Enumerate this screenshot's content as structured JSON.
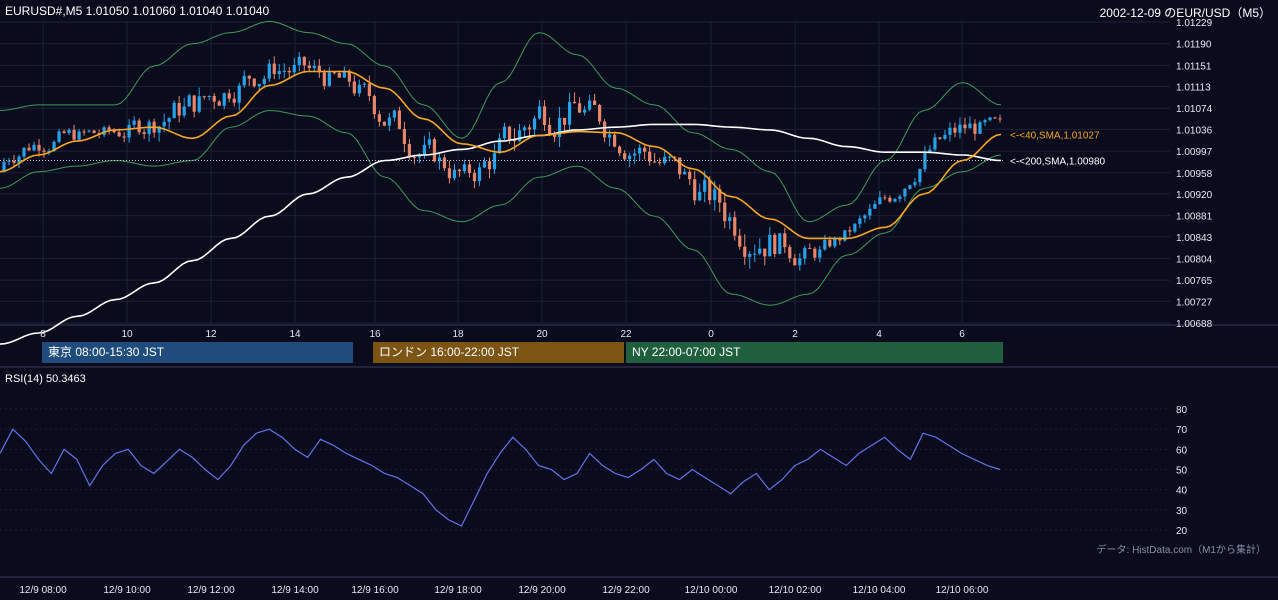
{
  "header": {
    "symbol_info": "EURUSD#,M5 1.01050 1.01060 1.01040 1.01040",
    "title": "2002-12-09 のEUR/USD（M5）"
  },
  "sessions": [
    {
      "label": "東京 08:00-15:30 JST",
      "color": "#1f4c7c"
    },
    {
      "label": "ロンドン 16:00-22:00 JST",
      "color": "#7c5414"
    },
    {
      "label": "NY 22:00-07:00 JST",
      "color": "#1f5f3d"
    }
  ],
  "rsi": {
    "title": "RSI(14) 50.3463"
  },
  "credit": "データ: HistData.com（M1から集計）",
  "colors": {
    "background": "#0b0b1e",
    "up": "#26a3e8",
    "down": "#e8866a",
    "sma40": "#f5a623",
    "sma200": "#ffffff",
    "bollinger": "#3e9a55",
    "rsi": "#6272e8"
  },
  "chart_data": {
    "type": "line",
    "price_axis": {
      "ticks": [
        "1.01229",
        "1.01190",
        "1.01151",
        "1.01113",
        "1.01074",
        "1.01036",
        "1.00997",
        "1.00958",
        "1.00920",
        "1.00881",
        "1.00843",
        "1.00804",
        "1.00765",
        "1.00727",
        "1.00688"
      ],
      "ylim": [
        1.00688,
        1.01229
      ]
    },
    "hour_axis": {
      "ticks": [
        "8",
        "10",
        "12",
        "14",
        "16",
        "18",
        "20",
        "22",
        "0",
        "2",
        "4",
        "6"
      ]
    },
    "time_axis": {
      "ticks": [
        "12/9 08:00",
        "12/9 10:00",
        "12/9 12:00",
        "12/9 14:00",
        "12/9 16:00",
        "12/9 18:00",
        "12/9 20:00",
        "12/9 22:00",
        "12/10 00:00",
        "12/10 02:00",
        "12/10 04:00",
        "12/10 06:00"
      ]
    },
    "price_line": 1.0098,
    "series": [
      {
        "name": "<-<40,SMA,1.01027",
        "values": [
          1.0096,
          1.0099,
          1.01015,
          1.01035,
          1.0104,
          1.0102,
          1.0106,
          1.01115,
          1.0114,
          1.0114,
          1.0111,
          1.01055,
          1.0101,
          1.00995,
          1.01025,
          1.01032,
          1.0103,
          1.01005,
          1.00965,
          1.00915,
          1.00875,
          1.0084,
          1.0084,
          1.0086,
          1.0092,
          1.0098,
          1.01027
        ]
      },
      {
        "name": "<-<200,SMA,1.00980",
        "values": [
          1.0065,
          1.0067,
          1.007,
          1.0073,
          1.0076,
          1.008,
          1.0084,
          1.0088,
          1.0092,
          1.0095,
          1.0098,
          1.0099,
          1.01,
          1.01015,
          1.01025,
          1.01035,
          1.0104,
          1.01045,
          1.01045,
          1.0104,
          1.01035,
          1.0102,
          1.01005,
          1.00995,
          1.00995,
          1.0099,
          1.0098
        ]
      },
      {
        "name": "",
        "values": [
          1.0107,
          1.0108,
          1.0108,
          1.0108,
          1.0115,
          1.0119,
          1.0121,
          1.0123,
          1.0121,
          1.0119,
          1.0115,
          1.0108,
          1.0102,
          1.0112,
          1.0121,
          1.0117,
          1.0111,
          1.0108,
          1.0103,
          1.01,
          1.0096,
          1.0087,
          1.009,
          1.0098,
          1.0107,
          1.0112,
          1.0108
        ]
      },
      {
        "name": "",
        "values": [
          1.0093,
          1.0096,
          1.0097,
          1.0098,
          1.0097,
          1.0098,
          1.0104,
          1.0107,
          1.0106,
          1.0103,
          1.0095,
          1.0089,
          1.0087,
          1.009,
          1.0095,
          1.0097,
          1.0093,
          1.0088,
          1.0082,
          1.0074,
          1.0072,
          1.0074,
          1.0081,
          1.0085,
          1.0093,
          1.0096,
          1.0099
        ]
      }
    ],
    "rsi_axis": {
      "ticks": [
        "80",
        "70",
        "60",
        "50",
        "40",
        "30",
        "20"
      ],
      "ylim": [
        20,
        80
      ]
    },
    "rsi_values": [
      58,
      70,
      64,
      55,
      48,
      60,
      55,
      42,
      52,
      58,
      60,
      52,
      48,
      54,
      60,
      56,
      50,
      45,
      52,
      62,
      68,
      70,
      66,
      60,
      56,
      65,
      62,
      58,
      55,
      52,
      48,
      46,
      42,
      38,
      30,
      25,
      22,
      35,
      48,
      58,
      66,
      60,
      52,
      50,
      45,
      48,
      58,
      52,
      48,
      46,
      50,
      55,
      48,
      45,
      50,
      46,
      42,
      38,
      44,
      48,
      40,
      45,
      52,
      55,
      60,
      56,
      52,
      58,
      62,
      66,
      60,
      55,
      68,
      66,
      62,
      58,
      55,
      52,
      50
    ]
  }
}
